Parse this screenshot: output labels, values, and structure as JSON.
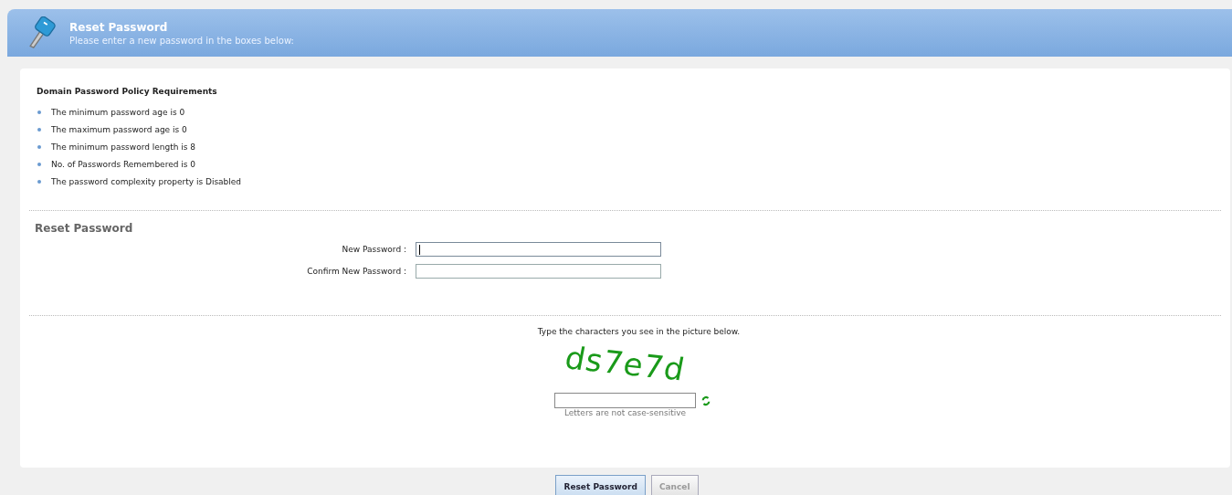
{
  "header": {
    "title": "Reset Password",
    "subtitle": "Please enter a new password in the boxes below:"
  },
  "policy": {
    "heading": "Domain Password Policy Requirements",
    "items": [
      "The minimum password age is 0",
      "The maximum password age is 0",
      "The minimum password length is 8",
      "No. of Passwords Remembered is 0",
      "The password complexity property is Disabled"
    ]
  },
  "reset_form": {
    "heading": "Reset Password",
    "fields": [
      {
        "label": "New Password :",
        "focused": true
      },
      {
        "label": "Confirm New Password :",
        "focused": false
      }
    ]
  },
  "captcha": {
    "instruction": "Type the characters you see in the picture below.",
    "image_text": "ds7e7d",
    "hint": "Letters are not case-sensitive"
  },
  "buttons": [
    {
      "label": "Reset Password",
      "kind": "primary"
    },
    {
      "label": "Cancel",
      "kind": "secondary"
    }
  ]
}
